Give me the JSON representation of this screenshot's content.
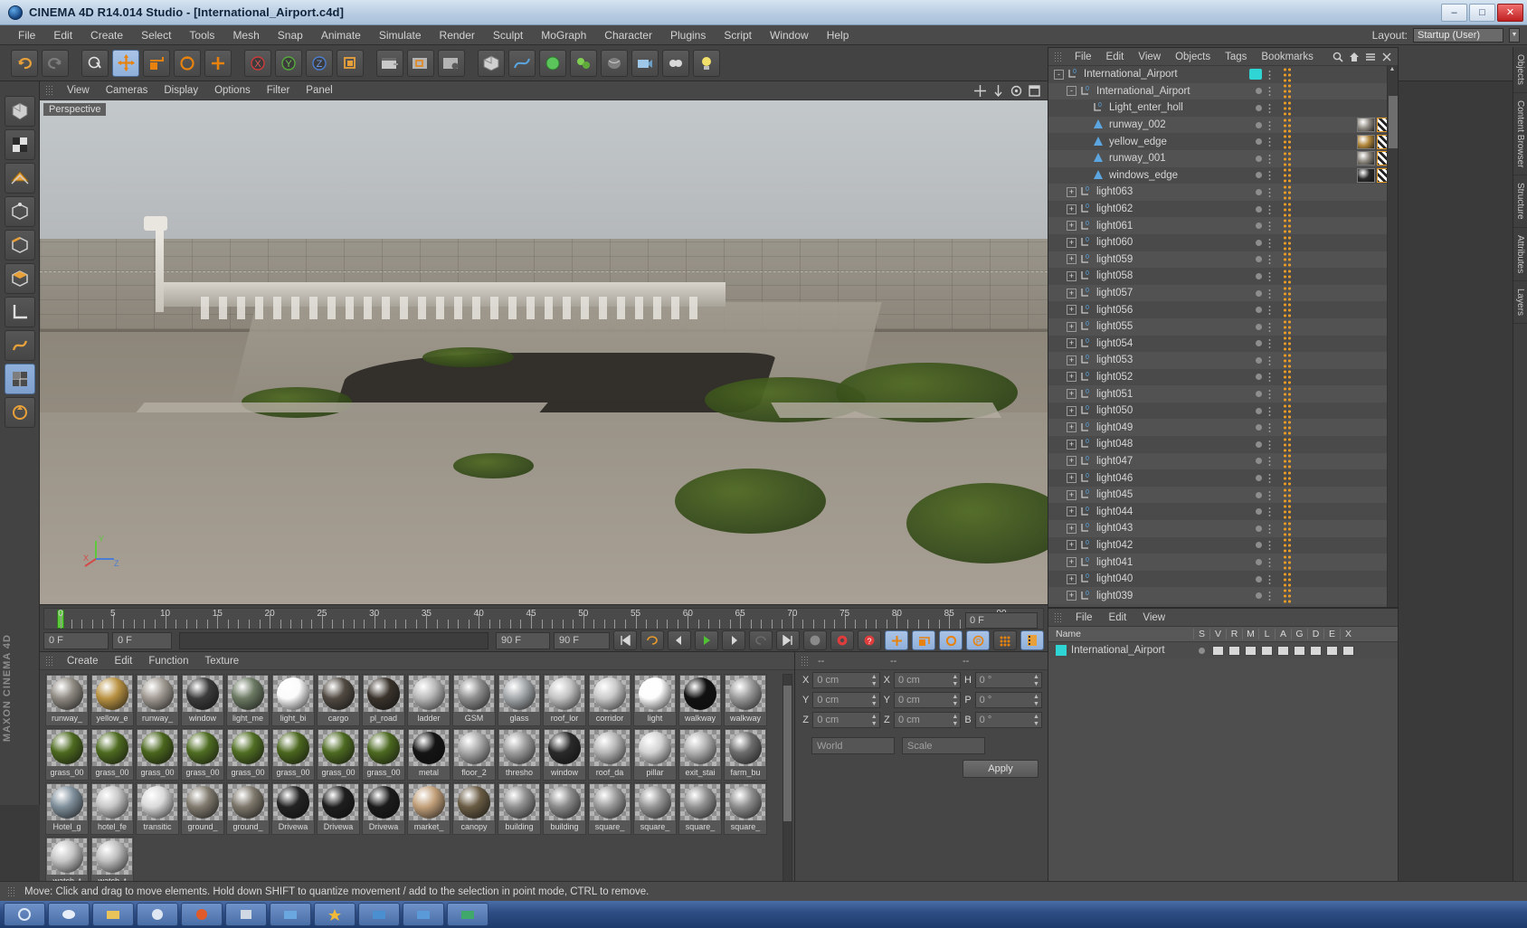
{
  "window": {
    "title": "CINEMA 4D R14.014 Studio - [International_Airport.c4d]",
    "icon": "c4d-logo-icon",
    "minimize": "–",
    "maximize": "□",
    "close": "✕"
  },
  "menubar": {
    "items": [
      "File",
      "Edit",
      "Create",
      "Select",
      "Tools",
      "Mesh",
      "Snap",
      "Animate",
      "Simulate",
      "Render",
      "Sculpt",
      "MoGraph",
      "Character",
      "Plugins",
      "Script",
      "Window",
      "Help"
    ],
    "layout_label": "Layout:",
    "layout_value": "Startup (User)"
  },
  "viewport": {
    "menu": [
      "View",
      "Cameras",
      "Display",
      "Options",
      "Filter",
      "Panel"
    ],
    "label": "Perspective",
    "axis": {
      "x": "X",
      "y": "Y",
      "z": "Z"
    }
  },
  "timeline": {
    "ticks": [
      0,
      5,
      10,
      15,
      20,
      25,
      30,
      35,
      40,
      45,
      50,
      55,
      60,
      65,
      70,
      75,
      80,
      85,
      90
    ],
    "current_frame_display": "0 F",
    "start_field": "0 F",
    "preview_start": "0 F",
    "preview_end": "90 F",
    "end_field": "90 F"
  },
  "material_manager": {
    "menu": [
      "Create",
      "Edit",
      "Function",
      "Texture"
    ],
    "materials": [
      {
        "name": "runway_",
        "color": "#8f8a82"
      },
      {
        "name": "yellow_e",
        "color": "#b99242"
      },
      {
        "name": "runway_",
        "color": "#a09a92"
      },
      {
        "name": "window",
        "color": "#3b3b3b"
      },
      {
        "name": "light_me",
        "color": "#6c7a63"
      },
      {
        "name": "light_bi",
        "color": "#fbfbfb"
      },
      {
        "name": "cargo",
        "color": "#514a42"
      },
      {
        "name": "pl_road",
        "color": "#3a332c"
      },
      {
        "name": "ladder",
        "color": "#b9b9b9"
      },
      {
        "name": "GSM",
        "color": "#8e8e8e"
      },
      {
        "name": "glass",
        "color": "#a4a8ab"
      },
      {
        "name": "roof_lor",
        "color": "#c3c3c3"
      },
      {
        "name": "corridor",
        "color": "#c9c9c9"
      },
      {
        "name": "light",
        "color": "#fdfdfd"
      },
      {
        "name": "walkway",
        "color": "#111111"
      },
      {
        "name": "walkway",
        "color": "#9a9a9a"
      },
      {
        "name": "grass_00",
        "color": "#4d6a1f"
      },
      {
        "name": "grass_00",
        "color": "#4e6b20"
      },
      {
        "name": "grass_00",
        "color": "#4a661d"
      },
      {
        "name": "grass_00",
        "color": "#4f6d22"
      },
      {
        "name": "grass_00",
        "color": "#506e23"
      },
      {
        "name": "grass_00",
        "color": "#4b671e"
      },
      {
        "name": "grass_00",
        "color": "#4d6a21"
      },
      {
        "name": "grass_00",
        "color": "#4c6920"
      },
      {
        "name": "metal",
        "color": "#141414"
      },
      {
        "name": "floor_2",
        "color": "#a9a9a9"
      },
      {
        "name": "thresho",
        "color": "#9d9d9d"
      },
      {
        "name": "window",
        "color": "#2a2a2a"
      },
      {
        "name": "roof_da",
        "color": "#b6b6b6"
      },
      {
        "name": "pillar",
        "color": "#d2d2d2"
      },
      {
        "name": "exit_stai",
        "color": "#b0b0b0"
      },
      {
        "name": "farm_bu",
        "color": "#6d6d6d"
      },
      {
        "name": "Hotel_g",
        "color": "#7f8f9b"
      },
      {
        "name": "hotel_fe",
        "color": "#c7c7c7"
      },
      {
        "name": "transitic",
        "color": "#d9d9d9"
      },
      {
        "name": "ground_",
        "color": "#807a6e"
      },
      {
        "name": "ground_",
        "color": "#7d776b"
      },
      {
        "name": "Drivewa",
        "color": "#232323"
      },
      {
        "name": "Drivewa",
        "color": "#1e1e1e"
      },
      {
        "name": "Drivewa",
        "color": "#1b1b1b"
      },
      {
        "name": "market_",
        "color": "#c2a07a"
      },
      {
        "name": "canopy",
        "color": "#6a5c44"
      },
      {
        "name": "building",
        "color": "#8f8f8f"
      },
      {
        "name": "building",
        "color": "#8a8a8a"
      },
      {
        "name": "square_",
        "color": "#9b9b9b"
      },
      {
        "name": "square_",
        "color": "#969696"
      },
      {
        "name": "square_",
        "color": "#929292"
      },
      {
        "name": "square_",
        "color": "#8d8d8d"
      },
      {
        "name": "watch_t",
        "color": "#c5c5c5"
      },
      {
        "name": "watch_t",
        "color": "#bdbdbd"
      }
    ]
  },
  "coordinates": {
    "header_dashes": [
      "--",
      "--",
      "--"
    ],
    "rows": [
      {
        "label": "X",
        "pos": "0 cm",
        "label2": "X",
        "size": "0 cm",
        "label3": "H",
        "rot": "0 °"
      },
      {
        "label": "Y",
        "pos": "0 cm",
        "label2": "Y",
        "size": "0 cm",
        "label3": "P",
        "rot": "0 °"
      },
      {
        "label": "Z",
        "pos": "0 cm",
        "label2": "Z",
        "size": "0 cm",
        "label3": "B",
        "rot": "0 °"
      }
    ],
    "coord_system": "World",
    "transform_mode": "Scale",
    "apply_label": "Apply"
  },
  "object_manager": {
    "menu": [
      "File",
      "Edit",
      "View",
      "Objects",
      "Tags",
      "Bookmarks"
    ],
    "items": [
      {
        "name": "International_Airport",
        "depth": 0,
        "expander": "-",
        "icon": "null-object-icon",
        "layer_color": "#2fd4d4",
        "tags": []
      },
      {
        "name": "International_Airport",
        "depth": 1,
        "expander": "-",
        "icon": "null-object-icon",
        "layer_color": "",
        "tags": []
      },
      {
        "name": "Light_enter_holl",
        "depth": 2,
        "expander": "",
        "icon": "null-object-icon",
        "layer_color": "",
        "tags": []
      },
      {
        "name": "runway_002",
        "depth": 2,
        "expander": "",
        "icon": "polygon-object-icon",
        "layer_color": "",
        "tags": [
          "material",
          "uv"
        ],
        "mat_color": "#8f8a82"
      },
      {
        "name": "yellow_edge",
        "depth": 2,
        "expander": "",
        "icon": "polygon-object-icon",
        "layer_color": "",
        "tags": [
          "material",
          "uv"
        ],
        "mat_color": "#b2873c"
      },
      {
        "name": "runway_001",
        "depth": 2,
        "expander": "",
        "icon": "polygon-object-icon",
        "layer_color": "",
        "tags": [
          "material",
          "uv"
        ],
        "mat_color": "#8a857c"
      },
      {
        "name": "windows_edge",
        "depth": 2,
        "expander": "",
        "icon": "polygon-object-icon",
        "layer_color": "",
        "tags": [
          "material",
          "uv"
        ],
        "mat_color": "#2a2a2a"
      },
      {
        "name": "light063",
        "depth": 1,
        "expander": "+",
        "icon": "null-object-icon",
        "layer_color": "",
        "tags": []
      },
      {
        "name": "light062",
        "depth": 1,
        "expander": "+",
        "icon": "null-object-icon",
        "layer_color": "",
        "tags": []
      },
      {
        "name": "light061",
        "depth": 1,
        "expander": "+",
        "icon": "null-object-icon",
        "layer_color": "",
        "tags": []
      },
      {
        "name": "light060",
        "depth": 1,
        "expander": "+",
        "icon": "null-object-icon",
        "layer_color": "",
        "tags": []
      },
      {
        "name": "light059",
        "depth": 1,
        "expander": "+",
        "icon": "null-object-icon",
        "layer_color": "",
        "tags": []
      },
      {
        "name": "light058",
        "depth": 1,
        "expander": "+",
        "icon": "null-object-icon",
        "layer_color": "",
        "tags": []
      },
      {
        "name": "light057",
        "depth": 1,
        "expander": "+",
        "icon": "null-object-icon",
        "layer_color": "",
        "tags": []
      },
      {
        "name": "light056",
        "depth": 1,
        "expander": "+",
        "icon": "null-object-icon",
        "layer_color": "",
        "tags": []
      },
      {
        "name": "light055",
        "depth": 1,
        "expander": "+",
        "icon": "null-object-icon",
        "layer_color": "",
        "tags": []
      },
      {
        "name": "light054",
        "depth": 1,
        "expander": "+",
        "icon": "null-object-icon",
        "layer_color": "",
        "tags": []
      },
      {
        "name": "light053",
        "depth": 1,
        "expander": "+",
        "icon": "null-object-icon",
        "layer_color": "",
        "tags": []
      },
      {
        "name": "light052",
        "depth": 1,
        "expander": "+",
        "icon": "null-object-icon",
        "layer_color": "",
        "tags": []
      },
      {
        "name": "light051",
        "depth": 1,
        "expander": "+",
        "icon": "null-object-icon",
        "layer_color": "",
        "tags": []
      },
      {
        "name": "light050",
        "depth": 1,
        "expander": "+",
        "icon": "null-object-icon",
        "layer_color": "",
        "tags": []
      },
      {
        "name": "light049",
        "depth": 1,
        "expander": "+",
        "icon": "null-object-icon",
        "layer_color": "",
        "tags": []
      },
      {
        "name": "light048",
        "depth": 1,
        "expander": "+",
        "icon": "null-object-icon",
        "layer_color": "",
        "tags": []
      },
      {
        "name": "light047",
        "depth": 1,
        "expander": "+",
        "icon": "null-object-icon",
        "layer_color": "",
        "tags": []
      },
      {
        "name": "light046",
        "depth": 1,
        "expander": "+",
        "icon": "null-object-icon",
        "layer_color": "",
        "tags": []
      },
      {
        "name": "light045",
        "depth": 1,
        "expander": "+",
        "icon": "null-object-icon",
        "layer_color": "",
        "tags": []
      },
      {
        "name": "light044",
        "depth": 1,
        "expander": "+",
        "icon": "null-object-icon",
        "layer_color": "",
        "tags": []
      },
      {
        "name": "light043",
        "depth": 1,
        "expander": "+",
        "icon": "null-object-icon",
        "layer_color": "",
        "tags": []
      },
      {
        "name": "light042",
        "depth": 1,
        "expander": "+",
        "icon": "null-object-icon",
        "layer_color": "",
        "tags": []
      },
      {
        "name": "light041",
        "depth": 1,
        "expander": "+",
        "icon": "null-object-icon",
        "layer_color": "",
        "tags": []
      },
      {
        "name": "light040",
        "depth": 1,
        "expander": "+",
        "icon": "null-object-icon",
        "layer_color": "",
        "tags": []
      },
      {
        "name": "light039",
        "depth": 1,
        "expander": "+",
        "icon": "null-object-icon",
        "layer_color": "",
        "tags": []
      }
    ]
  },
  "layer_manager": {
    "menu": [
      "File",
      "Edit",
      "View"
    ],
    "columns": [
      "Name",
      "S",
      "V",
      "R",
      "M",
      "L",
      "A",
      "G",
      "D",
      "E",
      "X"
    ],
    "rows": [
      {
        "name": "International_Airport",
        "color": "#2fd4d4"
      }
    ]
  },
  "right_tabs": [
    "Objects",
    "Content Browser",
    "Structure",
    "Attributes",
    "Layers"
  ],
  "status": {
    "text": "Move: Click and drag to move elements. Hold down SHIFT to quantize movement / add to the selection in point mode, CTRL to remove."
  },
  "branding": "MAXON CINEMA 4D"
}
